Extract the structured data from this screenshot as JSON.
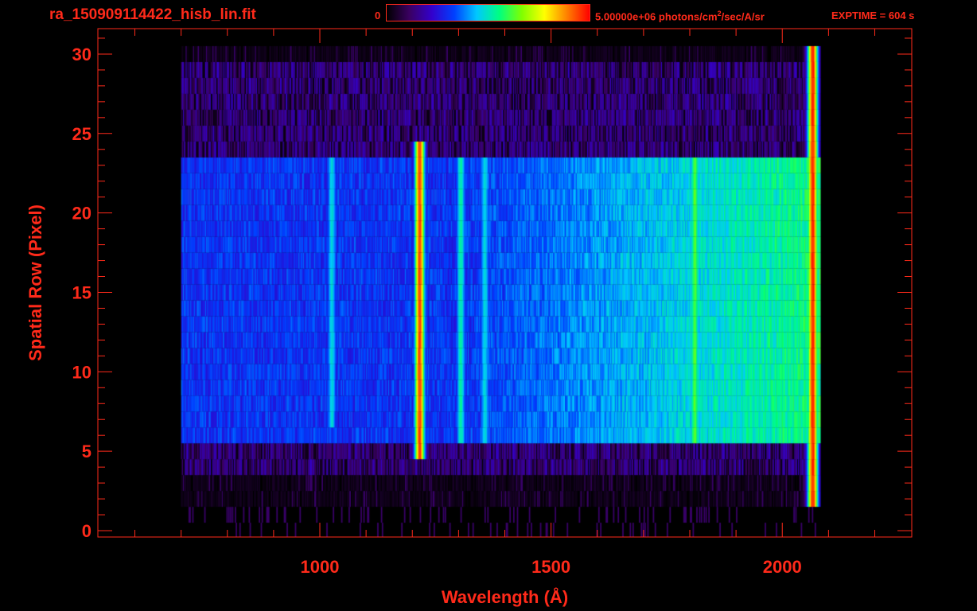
{
  "header": {
    "file_title": "ra_150909114422_hisb_lin.fit",
    "colorbar_min_label": "0",
    "colorbar_max_value": "5.00000e+06 photons/cm",
    "colorbar_max_exp": "2",
    "colorbar_max_units": "/sec/A/sr",
    "exptime_label": "EXPTIME = 604 s"
  },
  "colors": {
    "axis": "#ff2a1a",
    "background": "#000000",
    "colormap": [
      "#000000",
      "#3a0060",
      "#3300cc",
      "#0040ff",
      "#00c8ff",
      "#00ff80",
      "#80ff00",
      "#ffff00",
      "#ff8000",
      "#ff0000"
    ]
  },
  "chart_data": {
    "type": "heatmap",
    "title": "ra_150909114422_hisb_lin.fit",
    "xlabel": "Wavelength (Å)",
    "ylabel": "Spatial Row (Pixel)",
    "xlim": [
      520,
      2280
    ],
    "ylim": [
      -0.4,
      31.6
    ],
    "x_ticks": [
      1000,
      1500,
      2000
    ],
    "x_tick_labels": [
      "1000",
      "1500",
      "2000"
    ],
    "y_ticks": [
      0,
      5,
      10,
      15,
      20,
      25,
      30
    ],
    "y_tick_labels": [
      "0",
      "5",
      "10",
      "15",
      "20",
      "25",
      "30"
    ],
    "colorbar": {
      "min": 0,
      "max": 5000000,
      "units": "photons/cm^2/sec/A/sr"
    },
    "exptime_s": 604,
    "grid": false,
    "data_extent": {
      "x": [
        700,
        2080
      ],
      "rows": [
        0,
        30
      ]
    },
    "illuminated_rows": [
      6,
      23
    ],
    "emission_features": [
      {
        "wavelength": 1025,
        "rows": [
          7,
          23
        ],
        "level": 0.45
      },
      {
        "wavelength": 1215,
        "rows": [
          5,
          24
        ],
        "level": 0.92
      },
      {
        "wavelength": 1304,
        "rows": [
          6,
          23
        ],
        "level": 0.5
      },
      {
        "wavelength": 1356,
        "rows": [
          6,
          23
        ],
        "level": 0.45
      },
      {
        "wavelength": 1810,
        "rows": [
          6,
          23
        ],
        "level": 0.6
      },
      {
        "wavelength": 2065,
        "rows": [
          2,
          30
        ],
        "level": 0.95
      }
    ]
  }
}
